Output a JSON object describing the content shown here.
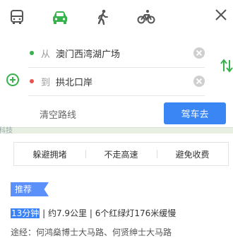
{
  "transport_modes": [
    {
      "icon": "bus-icon"
    },
    {
      "icon": "car-icon",
      "active": true
    },
    {
      "icon": "walk-icon"
    },
    {
      "icon": "bike-icon"
    }
  ],
  "colors": {
    "active": "#37b24d",
    "inactive": "#555555",
    "primary_button": "#3a86f4",
    "start_dot": "#37b24d",
    "end_dot": "#e9524a"
  },
  "route": {
    "from_prefix": "从",
    "from_place": "澳门西湾湖广场",
    "to_prefix": "到",
    "to_place": "拱北口岸",
    "clear_label": "清空路线",
    "drive_label": "驾车去"
  },
  "map_label": "科技",
  "options": [
    "躲避拥堵",
    "不走高速",
    "避免收费"
  ],
  "result": {
    "tag": "推荐",
    "time": "13分钟",
    "details": " | 约7.9公里 | 6个红绿灯176米缓慢",
    "via": "途经：何鸿燊博士大马路、何贤绅士大马路"
  }
}
